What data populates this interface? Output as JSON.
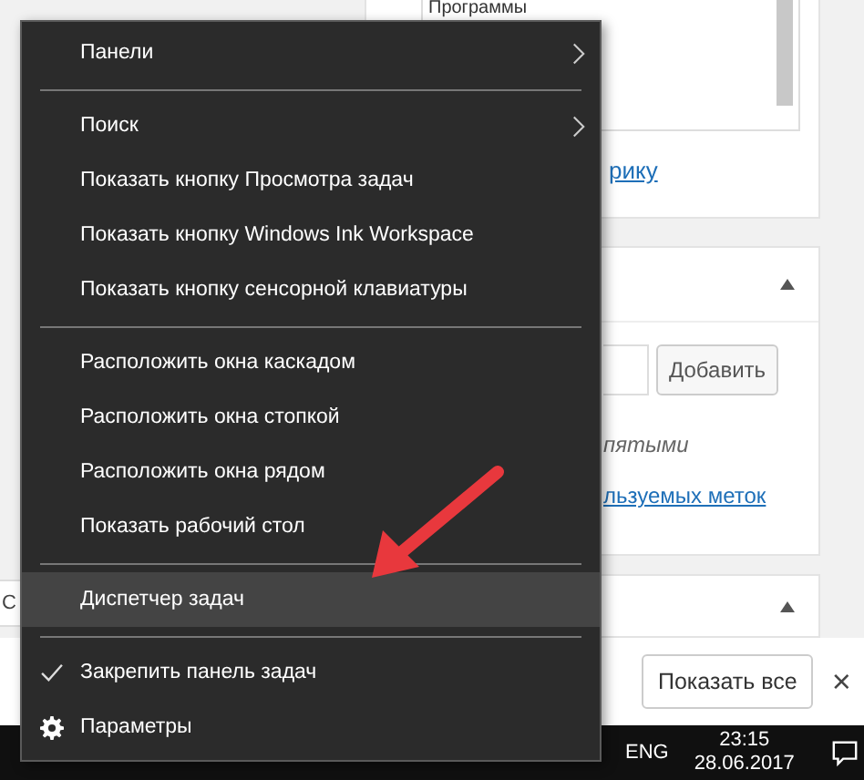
{
  "background": {
    "list_item": "Программы",
    "link_1": "рику",
    "add_button": "Добавить",
    "hint": "пятыми",
    "link_2": "льзуемых меток",
    "left_field": "С",
    "show_all_button": "Показать все",
    "close": "×"
  },
  "taskbar": {
    "language": "ENG",
    "time": "23:15",
    "date": "28.06.2017"
  },
  "menu": {
    "items": [
      {
        "kind": "item",
        "label": "Панели",
        "submenu": true,
        "checked": false,
        "selected": false
      },
      {
        "kind": "separator"
      },
      {
        "kind": "item",
        "label": "Поиск",
        "submenu": true,
        "checked": false,
        "selected": false
      },
      {
        "kind": "item",
        "label": "Показать кнопку Просмотра задач",
        "submenu": false,
        "checked": false,
        "selected": false
      },
      {
        "kind": "item",
        "label": "Показать кнопку Windows Ink Workspace",
        "submenu": false,
        "checked": false,
        "selected": false
      },
      {
        "kind": "item",
        "label": "Показать кнопку сенсорной клавиатуры",
        "submenu": false,
        "checked": false,
        "selected": false
      },
      {
        "kind": "separator"
      },
      {
        "kind": "item",
        "label": "Расположить окна каскадом",
        "submenu": false,
        "checked": false,
        "selected": false
      },
      {
        "kind": "item",
        "label": "Расположить окна стопкой",
        "submenu": false,
        "checked": false,
        "selected": false
      },
      {
        "kind": "item",
        "label": "Расположить окна рядом",
        "submenu": false,
        "checked": false,
        "selected": false
      },
      {
        "kind": "item",
        "label": "Показать рабочий стол",
        "submenu": false,
        "checked": false,
        "selected": false
      },
      {
        "kind": "separator"
      },
      {
        "kind": "item",
        "label": "Диспетчер задач",
        "submenu": false,
        "checked": false,
        "selected": true
      },
      {
        "kind": "separator"
      },
      {
        "kind": "item",
        "label": "Закрепить панель задач",
        "submenu": false,
        "checked": true,
        "selected": false
      },
      {
        "kind": "settings",
        "label": "Параметры",
        "submenu": false,
        "checked": false,
        "selected": false
      }
    ]
  }
}
